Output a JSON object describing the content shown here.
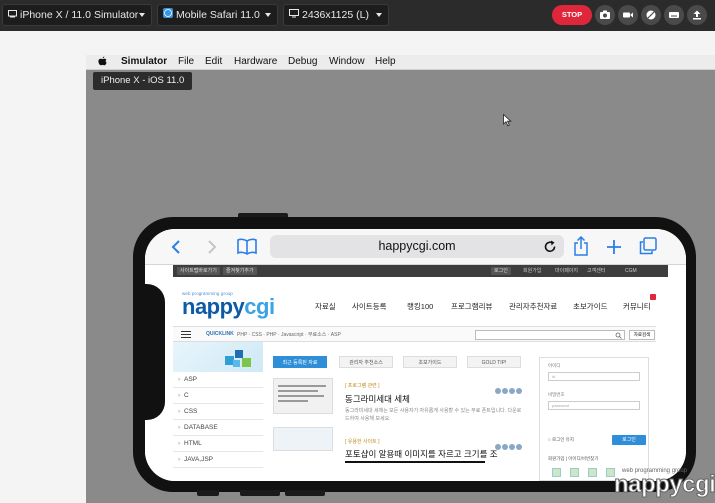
{
  "toolbar": {
    "device_dropdown": "iPhone X / 11.0 Simulator",
    "browser_dropdown": "Mobile Safari 11.0",
    "resolution_dropdown": "2436x1125 (L)",
    "stop_label": "STOP",
    "buttons": [
      "camera-icon",
      "video-icon",
      "bug-icon",
      "keyboard-icon",
      "upload-icon"
    ]
  },
  "mac_menubar": {
    "items": [
      "Simulator",
      "File",
      "Edit",
      "Hardware",
      "Debug",
      "Window",
      "Help"
    ]
  },
  "simulator": {
    "tooltip": "iPhone X - iOS 11.0"
  },
  "safari": {
    "url": "happycgi.com"
  },
  "site": {
    "logo_tag": "web programming group",
    "logo_text_a": "nappy",
    "logo_text_b": "cgi",
    "nav": [
      "자료실",
      "사이트등록",
      "랭킹100",
      "프로그램리뷰",
      "관리자추천자료",
      "초보가이드",
      "커뮤니티"
    ],
    "quicklink_label": "QUICKLINK",
    "quicklinks": "PHP · CSS · PHP · Javascript · 무료소스 · ASP",
    "search_button": "자료검색",
    "left_menu": [
      "ASP",
      "C",
      "CSS",
      "DATABASE",
      "HTML",
      "JAVA,JSP"
    ],
    "tabs": [
      "최근 등록된 자료",
      "관리자 추천소스",
      "초보가이드",
      "GOLD TIP!"
    ],
    "article1": {
      "category": "[ 프로그램 관련 ]",
      "title": "동그라미세대 세체",
      "desc": "동그라미세대 세체는 모든 사용자가 자유롭게 사용할 수 있는 무료 폰트입니다. 다운로드하여 사용해 보세요."
    },
    "article2": {
      "category": "[ 유용한 사이트 ]",
      "title": "포토샵이 알용때 이미지를 자르고 크기를 조"
    },
    "login": {
      "id_label": "아이디",
      "pw_label": "비밀번호",
      "id_value": "id",
      "pw_value": "password",
      "login_button": "로그인",
      "remember": "로그인 유지",
      "links": "회원가입 | 아이디/비번찾기"
    }
  },
  "watermark": {
    "small": "web programming group",
    "big": "nappycgi"
  }
}
